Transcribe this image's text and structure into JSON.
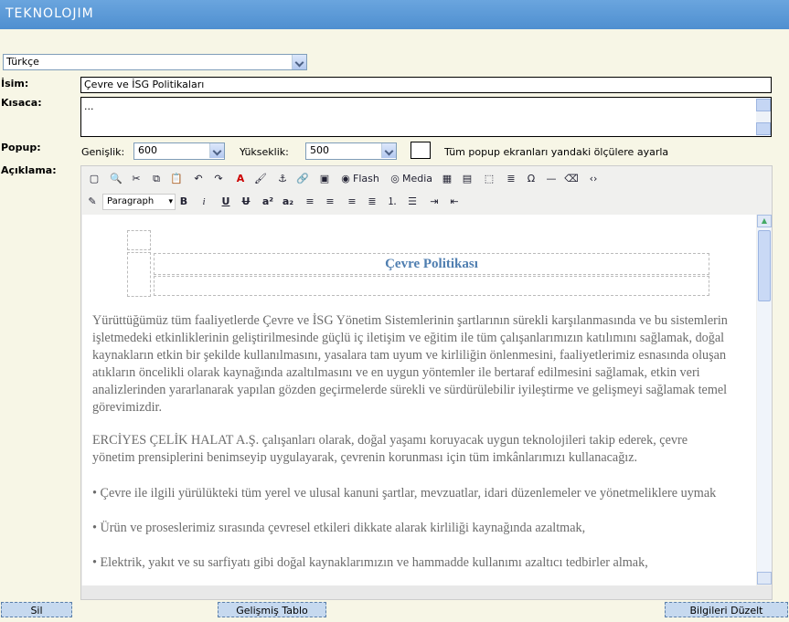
{
  "header": {
    "logo": "TEKNOLOJIM"
  },
  "language": {
    "selected": "Türkçe"
  },
  "labels": {
    "name": "İsim:",
    "summary": "Kısaca:",
    "popup": "Popup:",
    "description": "Açıklama:"
  },
  "fields": {
    "name_value": "Çevre ve İSG Politikaları",
    "summary_value": "..."
  },
  "popup": {
    "width_label": "Genişlik:",
    "width_value": "600",
    "height_label": "Yükseklik:",
    "height_value": "500",
    "apply_all_label": "Tüm popup ekranları yandaki ölçülere ayarla"
  },
  "toolbar": {
    "flash": "Flash",
    "media": "Media",
    "format": "Paragraph"
  },
  "content": {
    "heading": "Çevre Politikası",
    "lines": [
      "Yürüttüğümüz tüm faaliyetlerde Çevre ve İSG Yönetim Sistemlerinin şartlarının sürekli karşılanmasında ve bu sistemlerin",
      "işletmedeki etkinliklerinin geliştirilmesinde güçlü iç iletişim ve eğitim ile tüm çalışanlarımızın katılımını sağlamak, doğal",
      "kaynakların etkin bir şekilde kullanılmasını, yasalara tam uyum ve kirliliğin önlenmesini, faaliyetlerimiz esnasında oluşan",
      "atıkların öncelikli olarak kaynağında azaltılmasını ve en uygun yöntemler ile bertaraf edilmesini sağlamak, etkin veri",
      "analizlerinden yararlanarak yapılan gözden geçirmelerde sürekli ve sürdürülebilir iyileştirme ve gelişmeyi sağlamak temel",
      "görevimizdir."
    ],
    "para2": [
      "ERCİYES ÇELİK HALAT A.Ş. çalışanları olarak, doğal yaşamı koruyacak uygun teknolojileri takip ederek, çevre",
      "yönetim prensiplerini benimseyip uygulayarak, çevrenin korunması için tüm imkânlarımızı kullanacağız."
    ],
    "bullets": [
      "• Çevre ile ilgili yürülükteki tüm yerel ve ulusal kanuni şartlar, mevzuatlar, idari düzenlemeler ve yönetmeliklere uymak",
      "• Ürün ve proseslerimiz sırasında çevresel etkileri dikkate alarak kirliliği kaynağında azaltmak,",
      "• Elektrik, yakıt ve su sarfiyatı gibi doğal kaynaklarımızın ve hammadde kullanımı azaltıcı tedbirler almak,"
    ]
  },
  "buttons": {
    "delete": "Sil",
    "advanced_table": "Gelişmiş Tablo",
    "update": "Bilgileri Düzelt"
  }
}
